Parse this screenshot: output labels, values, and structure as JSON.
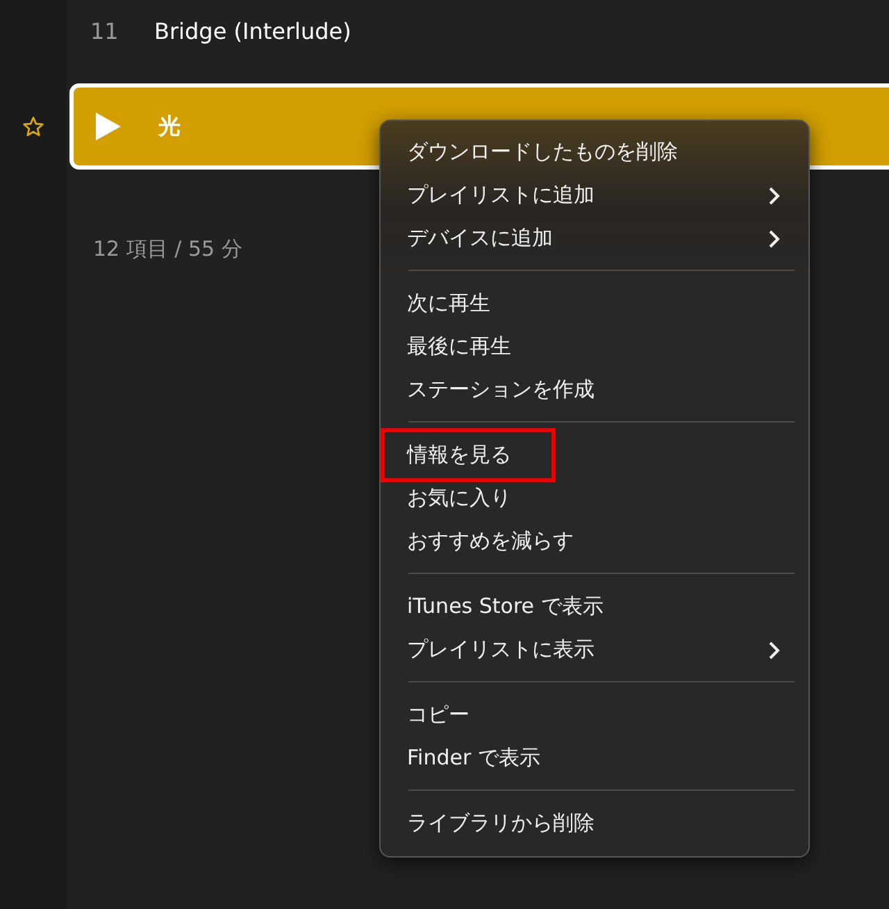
{
  "tracks": [
    {
      "number": "11",
      "title": "Bridge (Interlude)",
      "selected": false,
      "favorite": false,
      "playing": false
    },
    {
      "title": "光",
      "selected": true,
      "favorite": true,
      "playing": true
    }
  ],
  "summary": "12 項目 / 55 分",
  "context_menu": {
    "groups": [
      [
        {
          "label": "ダウンロードしたものを削除",
          "submenu": false,
          "highlighted": false
        },
        {
          "label": "プレイリストに追加",
          "submenu": true,
          "highlighted": false
        },
        {
          "label": "デバイスに追加",
          "submenu": true,
          "highlighted": false
        }
      ],
      [
        {
          "label": "次に再生",
          "submenu": false,
          "highlighted": false
        },
        {
          "label": "最後に再生",
          "submenu": false,
          "highlighted": false
        },
        {
          "label": "ステーションを作成",
          "submenu": false,
          "highlighted": false
        }
      ],
      [
        {
          "label": "情報を見る",
          "submenu": false,
          "highlighted": true
        },
        {
          "label": "お気に入り",
          "submenu": false,
          "highlighted": false
        },
        {
          "label": "おすすめを減らす",
          "submenu": false,
          "highlighted": false
        }
      ],
      [
        {
          "label": "iTunes Store で表示",
          "submenu": false,
          "highlighted": false
        },
        {
          "label": "プレイリストに表示",
          "submenu": true,
          "highlighted": false
        }
      ],
      [
        {
          "label": "コピー",
          "submenu": false,
          "highlighted": false
        },
        {
          "label": "Finder で表示",
          "submenu": false,
          "highlighted": false
        }
      ],
      [
        {
          "label": "ライブラリから削除",
          "submenu": false,
          "highlighted": false
        }
      ]
    ]
  }
}
